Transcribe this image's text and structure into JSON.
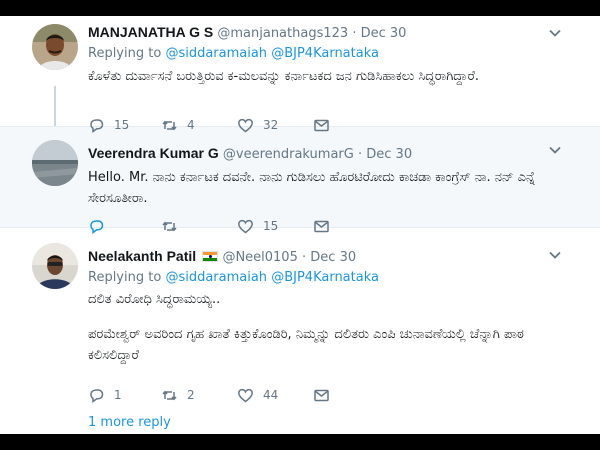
{
  "tweets": [
    {
      "name": "MANJANATHA G S",
      "handle": "@manjanathags123",
      "date": "Dec 30",
      "replying_prefix": "Replying to",
      "replying_to": [
        "@siddaramaiah",
        "@BJP4Karnataka"
      ],
      "text": [
        "ಕೊಳೆತು ದುರ್ವಾಸನೆ ಬರುತ್ತಿರುವ ಕ-ಮಲವನ್ನು ಕರ್ನಾಟಕದ ಜನ ಗುಡಿಸಿಹಾಕಲು ಸಿದ್ಧರಾಗಿದ್ದಾರೆ."
      ],
      "replies": "15",
      "retweets": "4",
      "likes": "32",
      "avatar_icon": "profile-photo-man"
    },
    {
      "name": "Veerendra Kumar G",
      "handle": "@veerendrakumarG",
      "date": "Dec 30",
      "text": [
        "Hello. Mr. ನಾನು ಕರ್ನಾಟಕ ದವನೇ. ನಾನು ಗುಡಿಸಲು ಹೊರಟಿರೋದು ಕಾಚಡಾ ಕಾಂಗ್ರೆಸ್ ನಾ. ನನ್ ಎನ್ನೆ  ಸೇರಸೂತೀರಾ."
      ],
      "replies": "",
      "retweets": "",
      "likes": "15",
      "avatar_icon": "profile-photo-landscape"
    },
    {
      "name": "Neelakanth Patil",
      "flag": "india-flag-icon",
      "handle": "@Neel0105",
      "date": "Dec 30",
      "replying_prefix": "Replying to",
      "replying_to": [
        "@siddaramaiah",
        "@BJP4Karnataka"
      ],
      "text": [
        "ದಲಿತ ವಿರೋಧಿ ಸಿದ್ಧರಾಮಯ್ಯ..",
        "ಪರಮೇಶ್ವರ್ ಅವರಿಂದ ಗೃಹ ಖಾತೆ ಕಿತ್ತುಕೊಂಡಿರಿ, ನಿಮ್ಮನ್ನು ದಲಿತರು ಎಂಪಿ ಚುನಾವಣೆಯಲ್ಲಿ ಚೆನ್ನಾಗಿ ಪಾಠ ಕಲಿಸಲಿದ್ದಾರೆ"
      ],
      "replies": "1",
      "retweets": "2",
      "likes": "44",
      "avatar_icon": "profile-photo-man-2",
      "more_replies": "1 more reply"
    }
  ],
  "colors": {
    "link": "#1b95e0",
    "muted": "#657786",
    "text": "#14171a",
    "highlight_bg": "#f5f8fa"
  },
  "icons": [
    "reply-icon",
    "retweet-icon",
    "like-icon",
    "message-icon",
    "chevron-down-icon"
  ]
}
